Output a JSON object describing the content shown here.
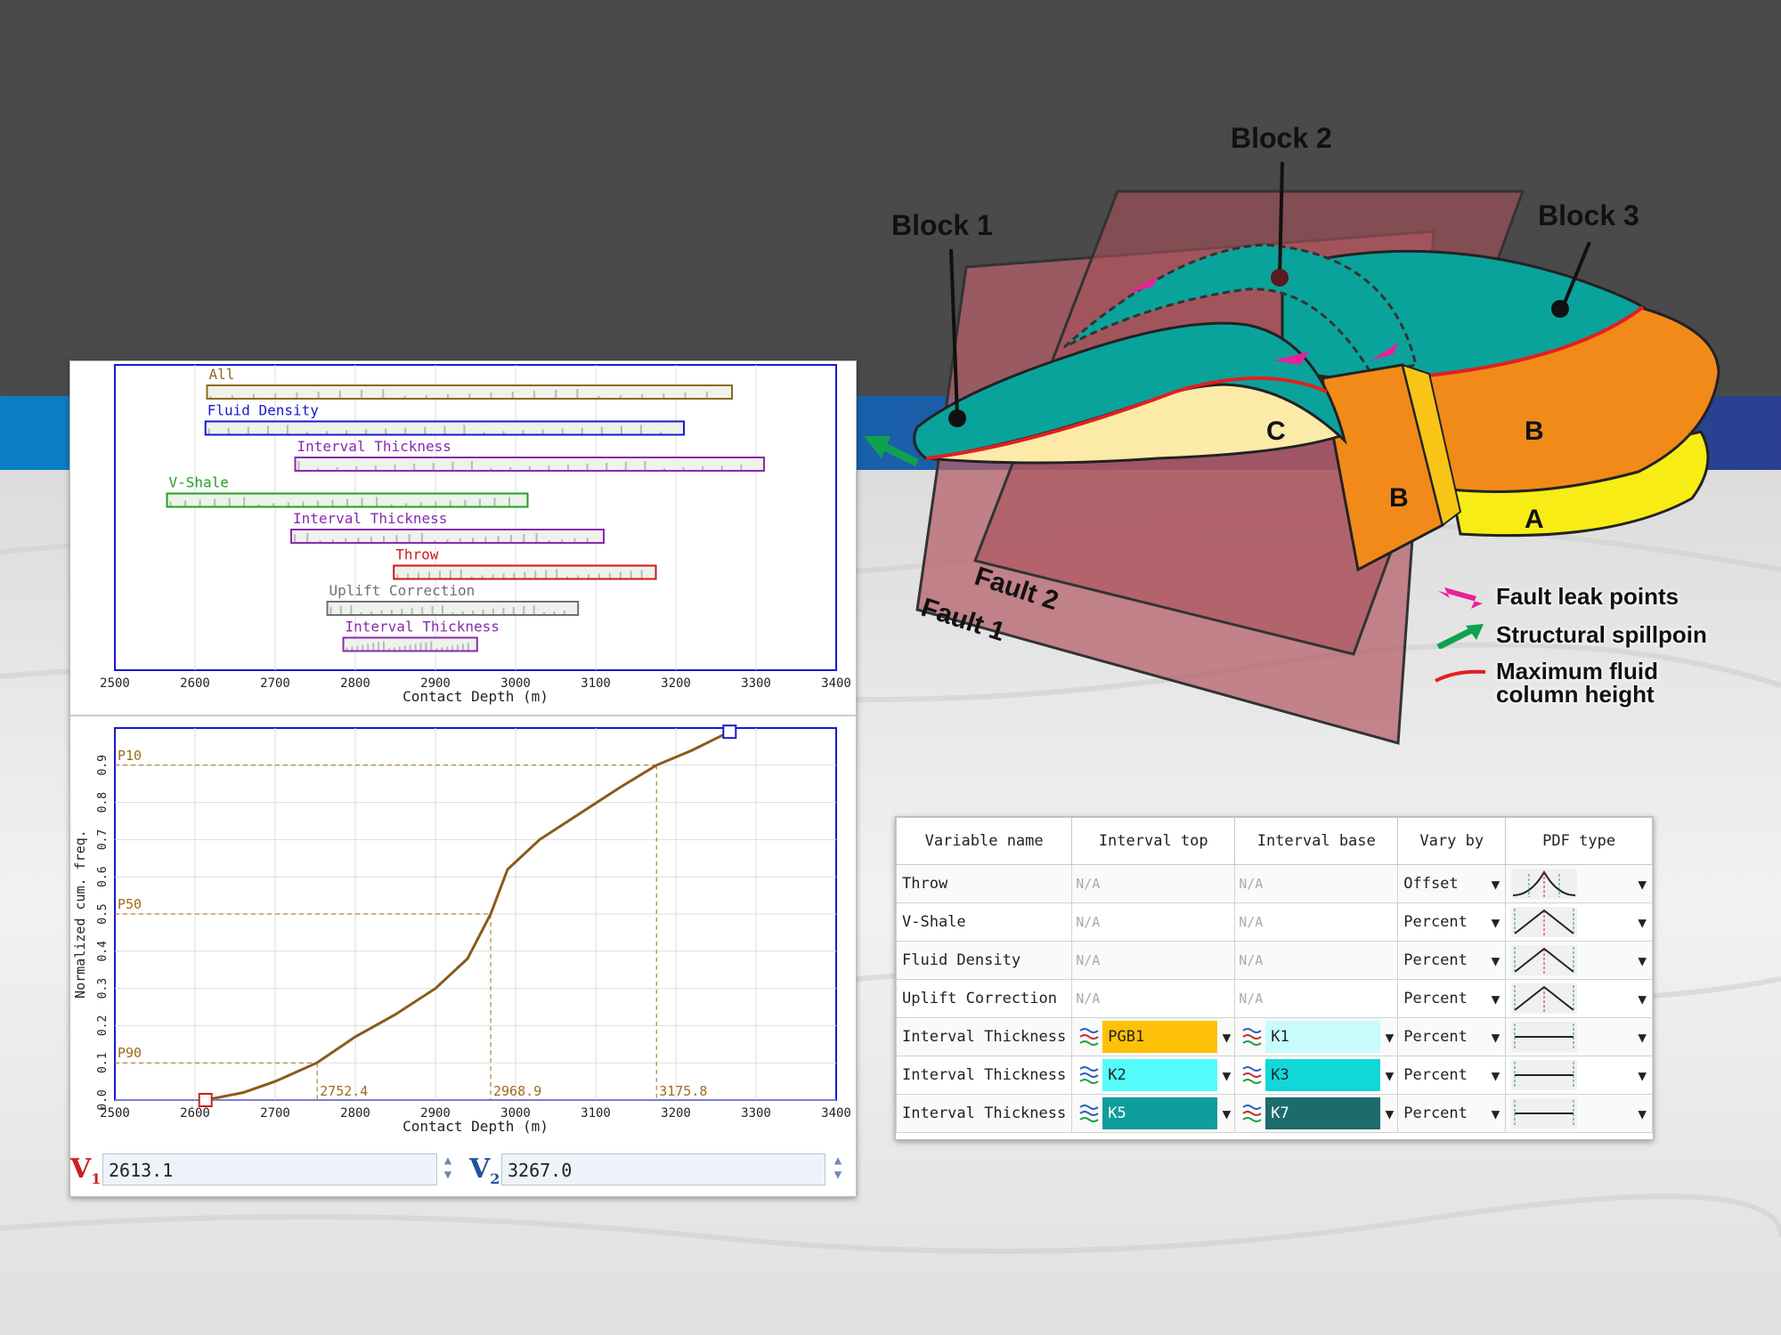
{
  "colors": {
    "dark_band": "#4a4a4a",
    "blue_band_left": "#0a7fc4",
    "blue_band_right": "#2a3f8f",
    "teal": "#0aa39b",
    "orange": "#f28a1a",
    "yellow": "#f8ec16",
    "cream": "#fbeaa8",
    "fault": "#b4606a",
    "cum_curve": "#8b5a1a",
    "frame": "#1a1acc"
  },
  "diagram": {
    "block1": "Block 1",
    "block2": "Block 2",
    "block3": "Block 3",
    "fault1": "Fault 1",
    "fault2": "Fault 2",
    "label_c": "C",
    "label_b_front": "B",
    "label_b_right": "B",
    "label_a": "A"
  },
  "legend": {
    "leak": "Fault leak points",
    "spill": "Structural spillpoin",
    "max_height_line1": "Maximum fluid",
    "max_height_line2": "column height"
  },
  "chart_data": [
    {
      "type": "bar",
      "subtype": "range-bars",
      "xlabel": "Contact Depth (m)",
      "xlim": [
        2500,
        3400
      ],
      "x_ticks": [
        "2500",
        "2600",
        "2700",
        "2800",
        "2900",
        "3000",
        "3100",
        "3200",
        "3300",
        "3400"
      ],
      "series": [
        {
          "name": "All",
          "min": 2615,
          "max": 3270,
          "color": "#8b6a1a"
        },
        {
          "name": "Fluid Density",
          "min": 2613,
          "max": 3210,
          "color": "#1a1acc"
        },
        {
          "name": "Interval Thickness",
          "min": 2725,
          "max": 3310,
          "color": "#8a2ab0"
        },
        {
          "name": "V-Shale",
          "min": 2565,
          "max": 3015,
          "color": "#20a020"
        },
        {
          "name": "Interval Thickness",
          "min": 2720,
          "max": 3110,
          "color": "#8a2ab0"
        },
        {
          "name": "Throw",
          "min": 2848,
          "max": 3175,
          "color": "#cc1a1a"
        },
        {
          "name": "Uplift Correction",
          "min": 2765,
          "max": 3078,
          "color": "#707070"
        },
        {
          "name": "Interval Thickness",
          "min": 2785,
          "max": 2952,
          "color": "#8a2ab0"
        }
      ]
    },
    {
      "type": "line",
      "xlabel": "Contact Depth (m)",
      "ylabel": "Normalized cum. freq.",
      "xlim": [
        2500,
        3400
      ],
      "ylim": [
        0,
        1
      ],
      "x_ticks": [
        "2500",
        "2600",
        "2700",
        "2800",
        "2900",
        "3000",
        "3100",
        "3200",
        "3300",
        "3400"
      ],
      "y_ticks": [
        "0.0",
        "0.1",
        "0.2",
        "0.3",
        "0.4",
        "0.5",
        "0.6",
        "0.7",
        "0.8",
        "0.9"
      ],
      "x": [
        2613,
        2660,
        2700,
        2752,
        2800,
        2850,
        2900,
        2940,
        2968.9,
        2990,
        3030,
        3080,
        3130,
        3175.8,
        3220,
        3267
      ],
      "y": [
        0.0,
        0.02,
        0.05,
        0.1,
        0.17,
        0.23,
        0.3,
        0.38,
        0.5,
        0.62,
        0.7,
        0.77,
        0.84,
        0.9,
        0.94,
        0.99
      ],
      "percentiles": [
        {
          "label": "P10",
          "y": 0.9,
          "x": 3175.8,
          "x_label": "3175.8"
        },
        {
          "label": "P50",
          "y": 0.5,
          "x": 2968.9,
          "x_label": "2968.9"
        },
        {
          "label": "P90",
          "y": 0.1,
          "x": 2752.4,
          "x_label": "2752.4"
        }
      ]
    }
  ],
  "inputs": {
    "v1_label": "V",
    "v1_sub": "1",
    "v1_value": "2613.1",
    "v2_label": "V",
    "v2_sub": "2",
    "v2_value": "3267.0"
  },
  "table": {
    "headers": [
      "Variable name",
      "Interval top",
      "Interval base",
      "Vary by",
      "PDF type"
    ],
    "na": "N/A",
    "rows": [
      {
        "name": "Throw",
        "top": "N/A",
        "base": "N/A",
        "vary": "Offset",
        "pdf": "normal"
      },
      {
        "name": "V-Shale",
        "top": "N/A",
        "base": "N/A",
        "vary": "Percent",
        "pdf": "triangle"
      },
      {
        "name": "Fluid Density",
        "top": "N/A",
        "base": "N/A",
        "vary": "Percent",
        "pdf": "triangle"
      },
      {
        "name": "Uplift Correction",
        "top": "N/A",
        "base": "N/A",
        "vary": "Percent",
        "pdf": "triangle"
      },
      {
        "name": "Interval Thickness",
        "top": "PGB1",
        "top_color": "#ffc107",
        "base": "K1",
        "base_color": "#c8fbfb",
        "vary": "Percent",
        "pdf": "uniform"
      },
      {
        "name": "Interval Thickness",
        "top": "K2",
        "top_color": "#55fbfb",
        "base": "K3",
        "base_color": "#10d8d8",
        "vary": "Percent",
        "pdf": "uniform"
      },
      {
        "name": "Interval Thickness",
        "top": "K5",
        "top_color": "#0e9d9d",
        "base": "K7",
        "base_color": "#1d6b6b",
        "vary": "Percent",
        "pdf": "uniform"
      }
    ]
  }
}
